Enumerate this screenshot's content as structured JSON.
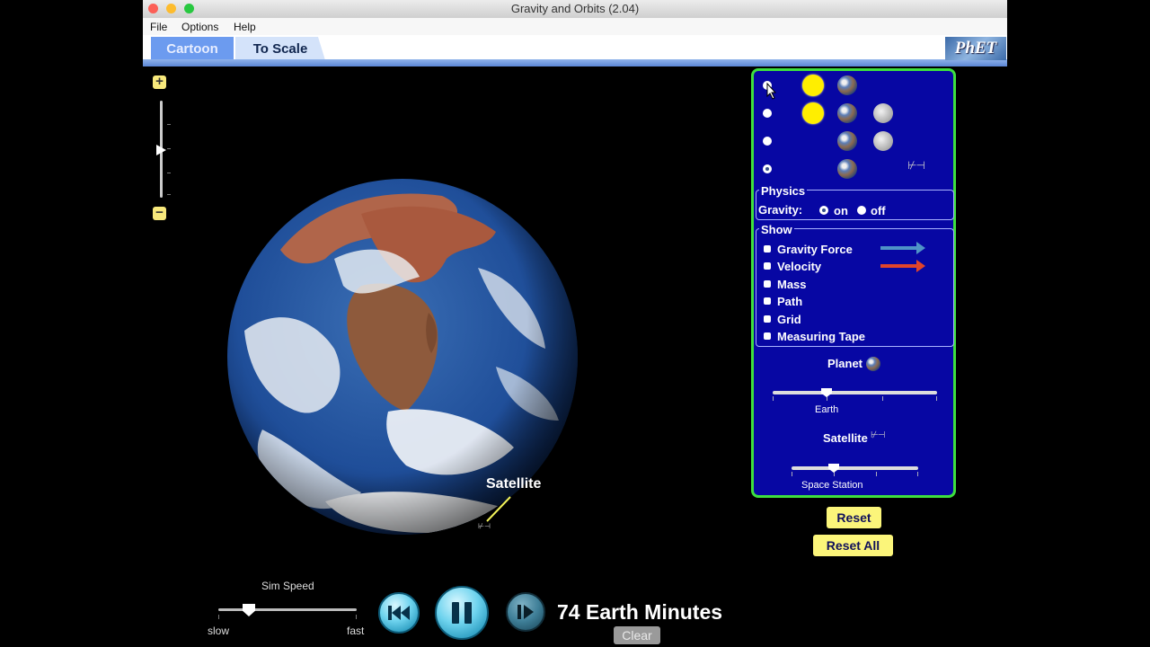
{
  "window": {
    "title": "Gravity and Orbits (2.04)"
  },
  "menu": {
    "items": [
      "File",
      "Options",
      "Help"
    ]
  },
  "tabs": [
    {
      "label": "Cartoon"
    },
    {
      "label": "To Scale"
    }
  ],
  "logo": {
    "text": "PhET"
  },
  "zoom": {
    "plus": "+",
    "minus": "−"
  },
  "scene": {
    "satellite_label": "Satellite"
  },
  "panel": {
    "physics": {
      "title": "Physics",
      "gravity_label": "Gravity:",
      "on_label": "on",
      "off_label": "off",
      "selected": "on"
    },
    "show": {
      "title": "Show",
      "items": [
        {
          "label": "Gravity Force",
          "arrow_color": "#4f93c7"
        },
        {
          "label": "Velocity",
          "arrow_color": "#e0442b"
        },
        {
          "label": "Mass"
        },
        {
          "label": "Path"
        },
        {
          "label": "Grid"
        },
        {
          "label": "Measuring Tape"
        }
      ]
    },
    "planet": {
      "title": "Planet",
      "value_label": "Earth",
      "level": 0.33
    },
    "satellite": {
      "title": "Satellite",
      "value_label": "Space Station",
      "level": 0.33
    },
    "selected_mode": 3,
    "station_glyph": "⊬⊣"
  },
  "buttons": {
    "reset": "Reset",
    "reset_all": "Reset All",
    "clear": "Clear"
  },
  "sim_speed": {
    "title": "Sim Speed",
    "min_label": "slow",
    "max_label": "fast",
    "level": 0.22
  },
  "time": {
    "readout": "74 Earth Minutes"
  },
  "colors": {
    "panel_bg": "#0707a3",
    "panel_border": "#3ee03e",
    "button_yellow": "#fbf57a"
  }
}
